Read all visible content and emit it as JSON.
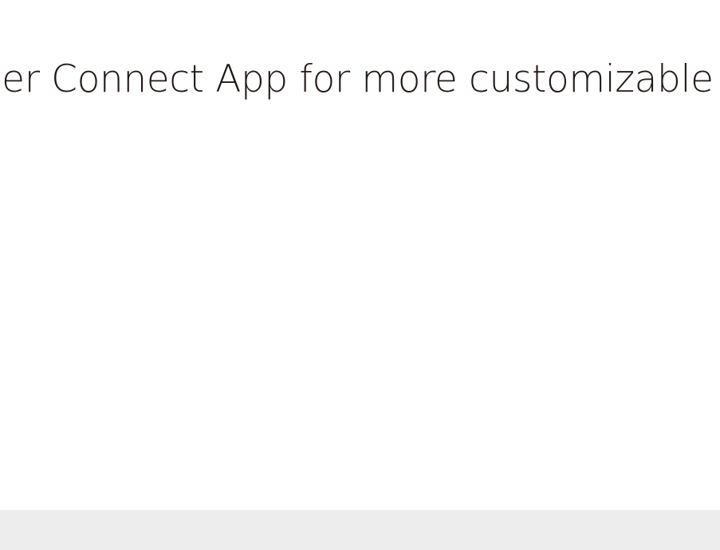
{
  "hero": {
    "headline": "dEdifier Connect App for more customizable co"
  }
}
